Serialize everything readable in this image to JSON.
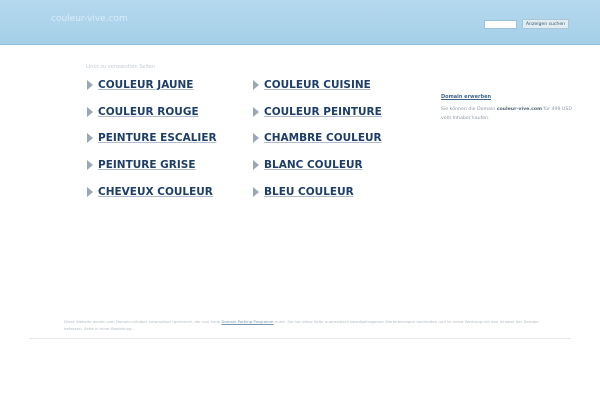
{
  "header": {
    "site_name": "couleur-vive.com",
    "search_placeholder": "",
    "search_button": "Anzeigen suchen"
  },
  "main": {
    "links_heading": "Links zu verwandten Seiten",
    "left_column": [
      "COULEUR JAUNE",
      "COULEUR ROUGE",
      "PEINTURE ESCALIER",
      "PEINTURE GRISE",
      "CHEVEUX COULEUR"
    ],
    "right_column": [
      "COULEUR CUISINE",
      "COULEUR PEINTURE",
      "CHAMBRE COULEUR",
      "BLANC COULEUR",
      "BLEU COULEUR"
    ]
  },
  "sidebar": {
    "title": "Domain erwerben",
    "text_before": "Sie können die Domain ",
    "domain": "couleur-vive.com",
    "text_after": " für 499 USD vom Inhaber kaufen."
  },
  "footer": {
    "text_before": "Diese Website wurde vom Domain-Inhaber automatisch generiert, der von Sedo ",
    "link": "Domain Parking Programm",
    "text_after": " nutzt. Sie hat diese Seite automatisch beaufgetragenen Werbeanzeigen beinhalten und ist keine Werbung mit den Inhaber der Domain befassen. Seite in einer Beziehung."
  },
  "colors": {
    "header_bg": "#a9d2ea",
    "link": "#1e3e68",
    "arrow": "#9aa8b6",
    "sidebar_title": "#3f6487"
  }
}
